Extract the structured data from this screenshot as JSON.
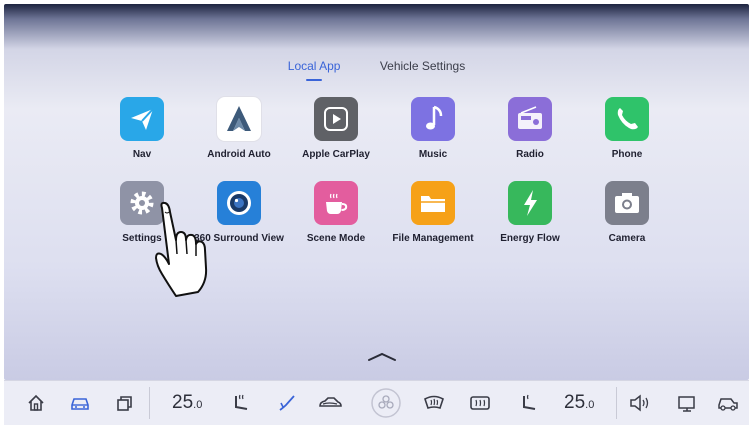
{
  "tabs": [
    {
      "label": "Local App",
      "active": true
    },
    {
      "label": "Vehicle Settings",
      "active": false
    }
  ],
  "apps": [
    {
      "label": "Nav",
      "icon": "navigation-arrow-icon",
      "color": "#29a7e8"
    },
    {
      "label": "Android Auto",
      "icon": "android-auto-icon",
      "color": "#ffffff"
    },
    {
      "label": "Apple CarPlay",
      "icon": "carplay-icon",
      "color": "#5f6166"
    },
    {
      "label": "Music",
      "icon": "music-note-icon",
      "color": "#7d72e2"
    },
    {
      "label": "Radio",
      "icon": "radio-icon",
      "color": "#8b6ed8"
    },
    {
      "label": "Phone",
      "icon": "phone-icon",
      "color": "#2fc36a"
    },
    {
      "label": "Settings",
      "icon": "gear-icon",
      "color": "#8f93a6"
    },
    {
      "label": "360 Surround View",
      "icon": "camera-lens-icon",
      "color": "#2680d8"
    },
    {
      "label": "Scene Mode",
      "icon": "coffee-cup-icon",
      "color": "#e35d9e"
    },
    {
      "label": "File Management",
      "icon": "folder-icon",
      "color": "#f6a118"
    },
    {
      "label": "Energy Flow",
      "icon": "lightning-icon",
      "color": "#37b85c"
    },
    {
      "label": "Camera",
      "icon": "camera-icon",
      "color": "#7c7f8c"
    }
  ],
  "bottom_bar": {
    "temp_left": "25",
    "temp_left_decimal": ".0",
    "temp_right": "25",
    "temp_right_decimal": ".0",
    "icons": [
      "home-icon",
      "car-icon",
      "windows-icon",
      "seat-heat-icon",
      "wiper-icon",
      "car-air-icon",
      "fan-icon",
      "front-defrost-icon",
      "rear-defrost-icon",
      "seat-icon",
      "volume-icon",
      "screen-icon",
      "car-settings-icon"
    ]
  },
  "colors": {
    "accent": "#3a64d8"
  }
}
